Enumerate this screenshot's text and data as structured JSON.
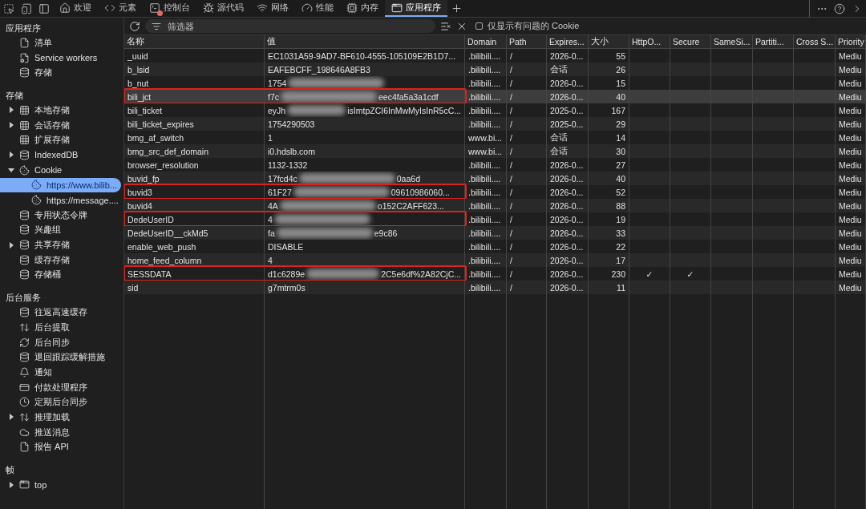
{
  "toolbar": {
    "tabs": [
      {
        "label": "欢迎",
        "selected": false,
        "error": false
      },
      {
        "label": "元素",
        "selected": false,
        "error": false
      },
      {
        "label": "控制台",
        "selected": false,
        "error": true
      },
      {
        "label": "源代码",
        "selected": false,
        "error": false
      },
      {
        "label": "网络",
        "selected": false,
        "error": false
      },
      {
        "label": "性能",
        "selected": false,
        "error": false
      },
      {
        "label": "内存",
        "selected": false,
        "error": false
      },
      {
        "label": "应用程序",
        "selected": true,
        "error": false
      }
    ]
  },
  "sidebar": {
    "sections": [
      {
        "heading": "应用程序",
        "items": [
          {
            "label": "清单",
            "kind": "file",
            "selected": false
          },
          {
            "label": "Service workers",
            "kind": "worker",
            "selected": false
          },
          {
            "label": "存储",
            "kind": "database",
            "selected": false
          }
        ]
      },
      {
        "heading": "存储",
        "items": [
          {
            "label": "本地存储",
            "kind": "grid",
            "selected": false,
            "expanded": false
          },
          {
            "label": "会话存储",
            "kind": "grid",
            "selected": false,
            "expanded": false
          },
          {
            "label": "扩展存储",
            "kind": "grid",
            "selected": false
          },
          {
            "label": "IndexedDB",
            "kind": "database",
            "selected": false,
            "expanded": false
          },
          {
            "label": "Cookie",
            "kind": "cookie",
            "selected": false,
            "expanded": true,
            "children": [
              {
                "label": "https://www.bilib...",
                "kind": "cookie",
                "selected": true
              },
              {
                "label": "https://message....",
                "kind": "cookie",
                "selected": false
              }
            ]
          },
          {
            "label": "专用状态令牌",
            "kind": "database",
            "selected": false
          },
          {
            "label": "兴趣组",
            "kind": "database",
            "selected": false
          },
          {
            "label": "共享存储",
            "kind": "database",
            "selected": false,
            "expanded": false
          },
          {
            "label": "缓存存储",
            "kind": "database",
            "selected": false
          },
          {
            "label": "存储桶",
            "kind": "database",
            "selected": false
          }
        ]
      },
      {
        "heading": "后台服务",
        "items": [
          {
            "label": "往返高速缓存",
            "kind": "database",
            "selected": false
          },
          {
            "label": "后台提取",
            "kind": "transfer",
            "selected": false
          },
          {
            "label": "后台同步",
            "kind": "sync",
            "selected": false
          },
          {
            "label": "退回跟踪缓解措施",
            "kind": "database",
            "selected": false
          },
          {
            "label": "通知",
            "kind": "notification",
            "selected": false
          },
          {
            "label": "付款处理程序",
            "kind": "payment",
            "selected": false
          },
          {
            "label": "定期后台同步",
            "kind": "periodic",
            "selected": false
          },
          {
            "label": "推理加载",
            "kind": "transfer",
            "selected": false,
            "expanded": false
          },
          {
            "label": "推送消息",
            "kind": "push",
            "selected": false
          },
          {
            "label": "报告 API",
            "kind": "file",
            "selected": false
          }
        ]
      },
      {
        "heading": "帧",
        "items": [
          {
            "label": "top",
            "kind": "frame",
            "selected": false,
            "expanded": false
          }
        ]
      }
    ]
  },
  "filter": {
    "placeholder": "筛选器",
    "only_issues": {
      "label": "仅显示有问题的 Cookie",
      "checked": false
    }
  },
  "table": {
    "columns": [
      "名称",
      "值",
      "Domain",
      "Path",
      "Expires...",
      "大小",
      "HttpO...",
      "Secure",
      "SameSi...",
      "Partiti...",
      "Cross S...",
      "Priority"
    ],
    "rows": [
      {
        "name": "_uuid",
        "value": "EC1031A59-9AD7-BF610-4555-105109E2B1D7...",
        "blurred": false,
        "domain": ".bilibili....",
        "path": "/",
        "expires": "2026-0...",
        "size": "55",
        "priority": "Mediu",
        "selected": false,
        "highlighted": false
      },
      {
        "name": "b_lsid",
        "value": "EAFEBCFF_198646A8FB3",
        "blurred": false,
        "domain": ".bilibili....",
        "path": "/",
        "expires": "会话",
        "size": "26",
        "priority": "Mediu",
        "selected": false,
        "highlighted": false
      },
      {
        "name": "b_nut",
        "value": "1754",
        "blurred": true,
        "domain": ".bilibili....",
        "path": "/",
        "expires": "2026-0...",
        "size": "15",
        "priority": "Mediu",
        "selected": false,
        "highlighted": false
      },
      {
        "name": "bili_jct",
        "value": "f7c",
        "blurred": true,
        "value_tail": "eec4fa5a3a1cdf",
        "domain": ".bilibili....",
        "path": "/",
        "expires": "2026-0...",
        "size": "40",
        "priority": "Mediu",
        "selected": true,
        "highlighted": true
      },
      {
        "name": "bili_ticket",
        "value": "eyJh",
        "blurred": true,
        "value_tail": "isImtpZCI6InMwMyIsInR5cC...",
        "domain": ".bilibili....",
        "path": "/",
        "expires": "2025-0...",
        "size": "167",
        "priority": "Mediu",
        "selected": false,
        "highlighted": false
      },
      {
        "name": "bili_ticket_expires",
        "value": "1754290503",
        "blurred": false,
        "domain": ".bilibili....",
        "path": "/",
        "expires": "2025-0...",
        "size": "29",
        "priority": "Mediu",
        "selected": false,
        "highlighted": false
      },
      {
        "name": "bmg_af_switch",
        "value": "1",
        "blurred": false,
        "domain": "www.bi...",
        "path": "/",
        "expires": "会话",
        "size": "14",
        "priority": "Mediu",
        "selected": false,
        "highlighted": false
      },
      {
        "name": "bmg_src_def_domain",
        "value": "i0.hdslb.com",
        "blurred": false,
        "domain": "www.bi...",
        "path": "/",
        "expires": "会话",
        "size": "30",
        "priority": "Mediu",
        "selected": false,
        "highlighted": false
      },
      {
        "name": "browser_resolution",
        "value": "1132-1332",
        "blurred": false,
        "domain": ".bilibili....",
        "path": "/",
        "expires": "2026-0...",
        "size": "27",
        "priority": "Mediu",
        "selected": false,
        "highlighted": false
      },
      {
        "name": "buvid_fp",
        "value": "17fcd4c",
        "blurred": true,
        "value_tail": "0aa6d",
        "domain": ".bilibili....",
        "path": "/",
        "expires": "2026-0...",
        "size": "40",
        "priority": "Mediu",
        "selected": false,
        "highlighted": false
      },
      {
        "name": "buvid3",
        "value": "61F27",
        "blurred": true,
        "value_tail": "09610986060...",
        "domain": ".bilibili....",
        "path": "/",
        "expires": "2026-0...",
        "size": "52",
        "priority": "Mediu",
        "selected": false,
        "highlighted": true
      },
      {
        "name": "buvid4",
        "value": "4A",
        "blurred": true,
        "value_tail": "o152C2AFF623...",
        "domain": ".bilibili....",
        "path": "/",
        "expires": "2026-0...",
        "size": "88",
        "priority": "Mediu",
        "selected": false,
        "highlighted": false
      },
      {
        "name": "DedeUserID",
        "value": "4",
        "blurred": true,
        "domain": ".bilibili....",
        "path": "/",
        "expires": "2026-0...",
        "size": "19",
        "priority": "Mediu",
        "selected": false,
        "highlighted": true
      },
      {
        "name": "DedeUserID__ckMd5",
        "value": "fa",
        "blurred": true,
        "value_tail": "e9c86",
        "domain": ".bilibili....",
        "path": "/",
        "expires": "2026-0...",
        "size": "33",
        "priority": "Mediu",
        "selected": false,
        "highlighted": false
      },
      {
        "name": "enable_web_push",
        "value": "DISABLE",
        "blurred": false,
        "domain": ".bilibili....",
        "path": "/",
        "expires": "2026-0...",
        "size": "22",
        "priority": "Mediu",
        "selected": false,
        "highlighted": false
      },
      {
        "name": "home_feed_column",
        "value": "4",
        "blurred": false,
        "domain": ".bilibili....",
        "path": "/",
        "expires": "2026-0...",
        "size": "17",
        "priority": "Mediu",
        "selected": false,
        "highlighted": false
      },
      {
        "name": "SESSDATA",
        "value": "d1c6289e",
        "blurred": true,
        "value_tail": "2C5e6df%2A82CjC...",
        "domain": ".bilibili....",
        "path": "/",
        "expires": "2026-0...",
        "size": "230",
        "http_only": "✓",
        "secure": "✓",
        "priority": "Mediu",
        "selected": false,
        "highlighted": true
      },
      {
        "name": "sid",
        "value": "g7mtrm0s",
        "blurred": false,
        "domain": ".bilibili....",
        "path": "/",
        "expires": "2026-0...",
        "size": "11",
        "priority": "Mediu",
        "selected": false,
        "highlighted": false
      }
    ]
  }
}
